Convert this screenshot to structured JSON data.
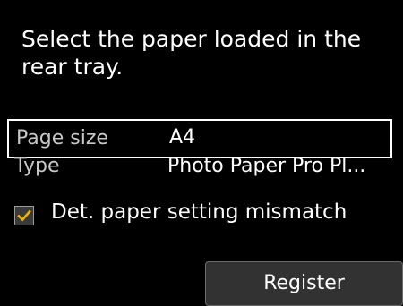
{
  "prompt": {
    "line1": "Select the paper loaded in the",
    "line2": "rear tray."
  },
  "settings": {
    "page_size": {
      "label": "Page size",
      "value": "A4",
      "selected": true
    },
    "type": {
      "label": "Type",
      "value": "Photo Paper Pro Pl..."
    }
  },
  "mismatch_option": {
    "label": "Det. paper setting mismatch",
    "checked": true,
    "check_color": "#f0b400"
  },
  "actions": {
    "register_label": "Register"
  }
}
